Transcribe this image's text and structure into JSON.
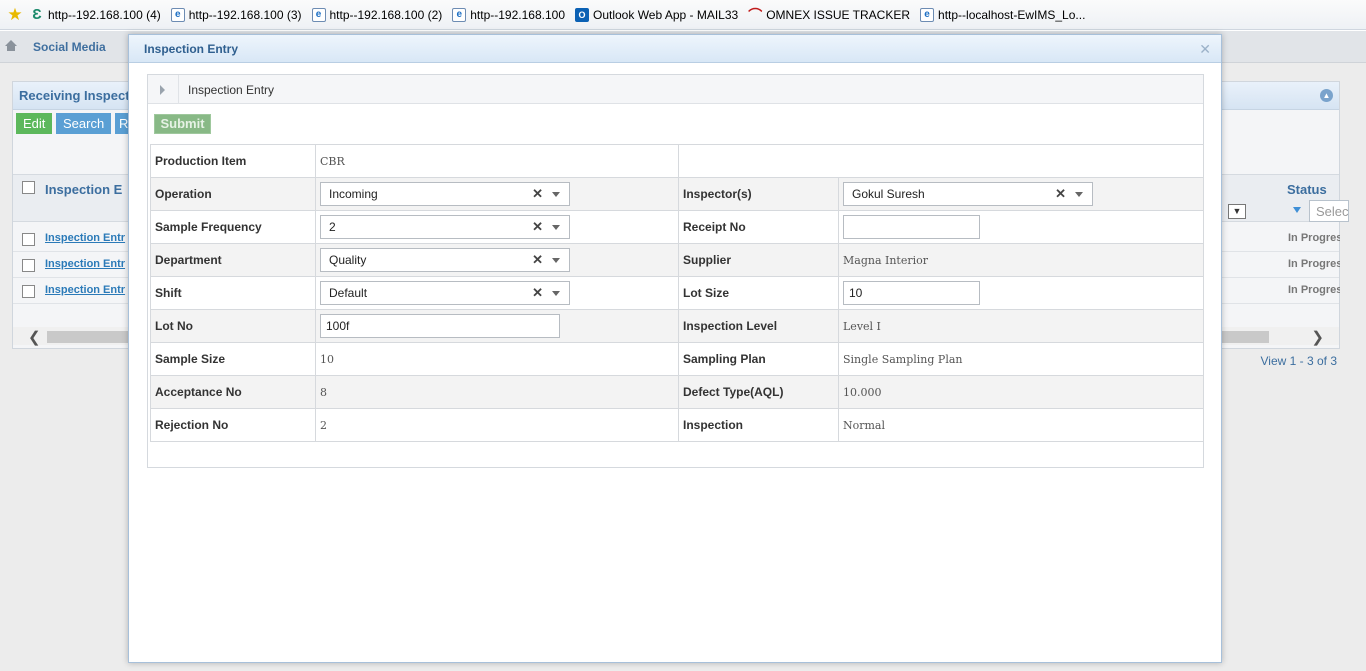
{
  "bookmarks": [
    {
      "icon": "site-e-icon",
      "label": "http--192.168.100 (4)"
    },
    {
      "icon": "ie-page-icon",
      "label": "http--192.168.100 (3)"
    },
    {
      "icon": "ie-page-icon",
      "label": "http--192.168.100 (2)"
    },
    {
      "icon": "ie-page-icon",
      "label": "http--192.168.100"
    },
    {
      "icon": "outlook-icon",
      "label": "Outlook Web App - MAIL33"
    },
    {
      "icon": "omnex-icon",
      "label": "OMNEX ISSUE TRACKER"
    },
    {
      "icon": "ie-page-icon",
      "label": "http--localhost-EwIMS_Lo..."
    }
  ],
  "background": {
    "nav_label": "Social Media",
    "panel_title": "Receiving Inspect",
    "buttons": {
      "edit": "Edit",
      "search": "Search",
      "r": "R"
    },
    "grid_col_title": "Inspection E",
    "status_col_title": "Status",
    "status_filter_placeholder": "Selec",
    "rows": [
      {
        "link": "Inspection Entr",
        "status": "In Progres"
      },
      {
        "link": "Inspection Entr",
        "status": "In Progres"
      },
      {
        "link": "Inspection Entr",
        "status": "In Progres"
      }
    ],
    "pager_text": "View 1 - 3 of 3"
  },
  "modal": {
    "title": "Inspection Entry",
    "section_title": "Inspection Entry",
    "submit_label": "Submit",
    "fields": {
      "production_item": {
        "label": "Production Item",
        "value": "CBR"
      },
      "operation": {
        "label": "Operation",
        "value": "Incoming"
      },
      "inspectors": {
        "label": "Inspector(s)",
        "value": "Gokul Suresh"
      },
      "sample_frequency": {
        "label": "Sample Frequency",
        "value": "2"
      },
      "receipt_no": {
        "label": "Receipt No",
        "value": ""
      },
      "department": {
        "label": "Department",
        "value": "Quality"
      },
      "supplier": {
        "label": "Supplier",
        "value": "Magna Interior"
      },
      "shift": {
        "label": "Shift",
        "value": "Default"
      },
      "lot_size": {
        "label": "Lot Size",
        "value": "10"
      },
      "lot_no": {
        "label": "Lot No",
        "value": "100f"
      },
      "inspection_level": {
        "label": "Inspection Level",
        "value": "Level I"
      },
      "sample_size": {
        "label": "Sample Size",
        "value": "10"
      },
      "sampling_plan": {
        "label": "Sampling Plan",
        "value": "Single Sampling Plan"
      },
      "acceptance_no": {
        "label": "Acceptance No",
        "value": "8"
      },
      "defect_type": {
        "label": "Defect Type(AQL)",
        "value": "10.000"
      },
      "rejection_no": {
        "label": "Rejection No",
        "value": "2"
      },
      "inspection": {
        "label": "Inspection",
        "value": "Normal"
      }
    }
  }
}
